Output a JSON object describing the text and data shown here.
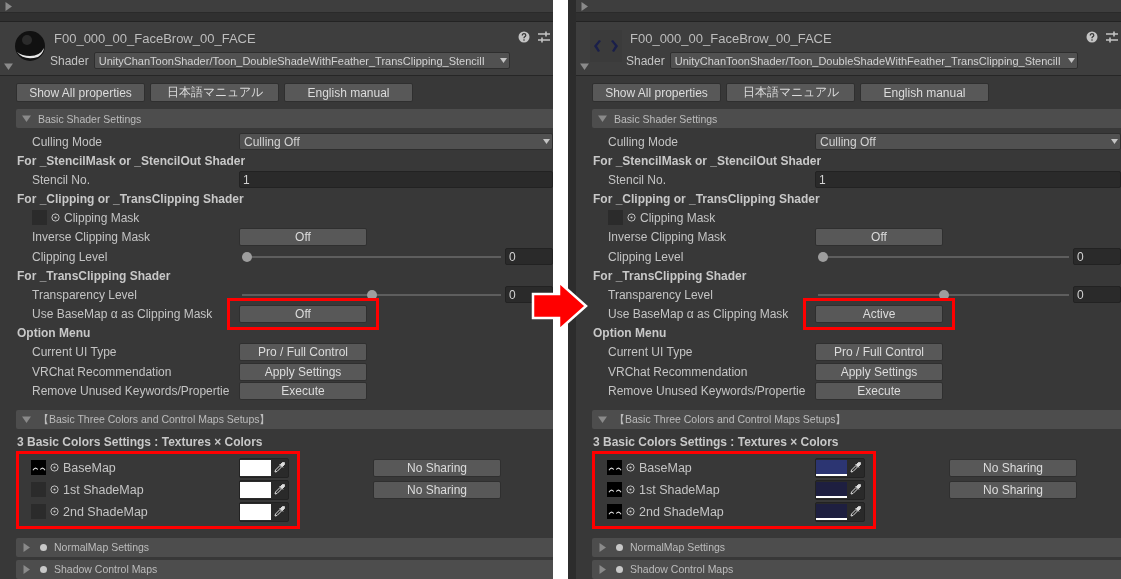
{
  "panels": [
    {
      "material": {
        "title": "F00_000_00_FaceBrow_00_FACE",
        "preview": {
          "kind": "sphere"
        },
        "shader_label": "Shader",
        "shader": "UnityChanToonShader/Toon_DoubleShadeWithFeather_TransClipping_StencilI"
      },
      "buttons": [
        "Show All properties",
        "日本語マニュアル",
        "English manual"
      ],
      "sections": [
        {
          "title": "Basic Shader Settings",
          "expanded": true,
          "items": [
            {
              "kind": "dropdown",
              "label": "Culling Mode",
              "value": "Culling Off"
            },
            {
              "kind": "heading",
              "label": "For _StencilMask or _StencilOut Shader"
            },
            {
              "kind": "field",
              "label": "Stencil No.",
              "value": "1"
            },
            {
              "kind": "heading",
              "label": "For _Clipping or _TransClipping Shader"
            },
            {
              "kind": "texture",
              "label": "Clipping Mask",
              "texture": false
            },
            {
              "kind": "button",
              "label": "Inverse Clipping Mask",
              "value": "Off"
            },
            {
              "kind": "slider",
              "label": "Clipping Level",
              "level": 0,
              "value": "0"
            },
            {
              "kind": "heading",
              "label": "For _TransClipping Shader"
            },
            {
              "kind": "slider",
              "label": "Transparency Level",
              "level": 0.5,
              "value": "0"
            },
            {
              "kind": "button",
              "label": "Use BaseMap α as Clipping Mask",
              "value": "Off",
              "highlight": true
            },
            {
              "kind": "heading",
              "label": "Option Menu"
            },
            {
              "kind": "button",
              "label": "Current UI Type",
              "value": "Pro / Full Control"
            },
            {
              "kind": "button",
              "label": "VRChat Recommendation",
              "value": "Apply Settings"
            },
            {
              "kind": "button",
              "label": "Remove Unused Keywords/Propertie",
              "value": "Execute"
            }
          ]
        },
        {
          "title": "【Basic Three Colors and Control Maps Setups】",
          "expanded": true,
          "items": [
            {
              "kind": "heading",
              "label": "3 Basic Colors Settings : Textures × Colors"
            },
            {
              "kind": "colors",
              "highlight": true,
              "rows": [
                {
                  "label": "BaseMap",
                  "texture": true,
                  "color": "#ffffff",
                  "sharing": "No Sharing"
                },
                {
                  "label": "1st ShadeMap",
                  "texture": false,
                  "color": "#ffffff",
                  "sharing": "No Sharing"
                },
                {
                  "label": "2nd ShadeMap",
                  "texture": false,
                  "color": "#ffffff"
                }
              ]
            }
          ]
        },
        {
          "title": "NormalMap Settings",
          "bullet": true,
          "expanded": false
        },
        {
          "title": "Shadow Control Maps",
          "bullet": true,
          "expanded": false
        }
      ]
    },
    {
      "material": {
        "title": "F00_000_00_FaceBrow_00_FACE",
        "preview": {
          "kind": "brows"
        },
        "shader_label": "Shader",
        "shader": "UnityChanToonShader/Toon_DoubleShadeWithFeather_TransClipping_StencilI"
      },
      "buttons": [
        "Show All properties",
        "日本語マニュアル",
        "English manual"
      ],
      "sections": [
        {
          "title": "Basic Shader Settings",
          "expanded": true,
          "items": [
            {
              "kind": "dropdown",
              "label": "Culling Mode",
              "value": "Culling Off"
            },
            {
              "kind": "heading",
              "label": "For _StencilMask or _StencilOut Shader"
            },
            {
              "kind": "field",
              "label": "Stencil No.",
              "value": "1"
            },
            {
              "kind": "heading",
              "label": "For _Clipping or _TransClipping Shader"
            },
            {
              "kind": "texture",
              "label": "Clipping Mask",
              "texture": false
            },
            {
              "kind": "button",
              "label": "Inverse Clipping Mask",
              "value": "Off"
            },
            {
              "kind": "slider",
              "label": "Clipping Level",
              "level": 0,
              "value": "0"
            },
            {
              "kind": "heading",
              "label": "For _TransClipping Shader"
            },
            {
              "kind": "slider",
              "label": "Transparency Level",
              "level": 0.5,
              "value": "0"
            },
            {
              "kind": "button",
              "label": "Use BaseMap α as Clipping Mask",
              "value": "Active",
              "highlight": true
            },
            {
              "kind": "heading",
              "label": "Option Menu"
            },
            {
              "kind": "button",
              "label": "Current UI Type",
              "value": "Pro / Full Control"
            },
            {
              "kind": "button",
              "label": "VRChat Recommendation",
              "value": "Apply Settings"
            },
            {
              "kind": "button",
              "label": "Remove Unused Keywords/Propertie",
              "value": "Execute"
            }
          ]
        },
        {
          "title": "【Basic Three Colors and Control Maps Setups】",
          "expanded": true,
          "items": [
            {
              "kind": "heading",
              "label": "3 Basic Colors Settings : Textures × Colors"
            },
            {
              "kind": "colors",
              "highlight": true,
              "rows": [
                {
                  "label": "BaseMap",
                  "texture": true,
                  "color": "#2c3572",
                  "sharing": "No Sharing"
                },
                {
                  "label": "1st ShadeMap",
                  "texture": true,
                  "color": "#1e1f40",
                  "sharing": "No Sharing"
                },
                {
                  "label": "2nd ShadeMap",
                  "texture": true,
                  "color": "#1e1f40"
                }
              ]
            }
          ]
        },
        {
          "title": "NormalMap Settings",
          "bullet": true,
          "expanded": false
        },
        {
          "title": "Shadow Control Maps",
          "bullet": true,
          "expanded": false
        }
      ]
    }
  ]
}
